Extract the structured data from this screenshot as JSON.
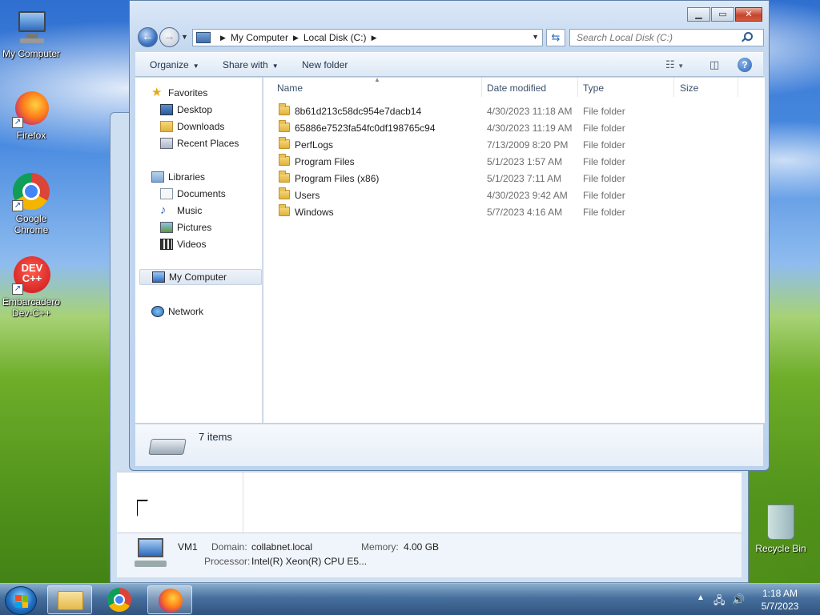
{
  "desktop": {
    "icons": [
      {
        "label": "My Computer"
      },
      {
        "label": "Firefox"
      },
      {
        "label": "Google Chrome"
      },
      {
        "label": "Embarcadero Dev-C++"
      }
    ],
    "recycle_bin": "Recycle Bin"
  },
  "explorer": {
    "address": {
      "segments": [
        "My Computer",
        "Local Disk (C:)"
      ]
    },
    "search_placeholder": "Search Local Disk (C:)",
    "toolbar": {
      "organize": "Organize",
      "share_with": "Share with",
      "new_folder": "New folder"
    },
    "nav": {
      "favorites": "Favorites",
      "desktop": "Desktop",
      "downloads": "Downloads",
      "recent_places": "Recent Places",
      "libraries": "Libraries",
      "documents": "Documents",
      "music": "Music",
      "pictures": "Pictures",
      "videos": "Videos",
      "my_computer": "My Computer",
      "network": "Network"
    },
    "columns": {
      "name": "Name",
      "date_modified": "Date modified",
      "type": "Type",
      "size": "Size"
    },
    "files": [
      {
        "name": "8b61d213c58dc954e7dacb14",
        "date": "4/30/2023 11:18 AM",
        "type": "File folder"
      },
      {
        "name": "65886e7523fa54fc0df198765c94",
        "date": "4/30/2023 11:19 AM",
        "type": "File folder"
      },
      {
        "name": "PerfLogs",
        "date": "7/13/2009 8:20 PM",
        "type": "File folder"
      },
      {
        "name": "Program Files",
        "date": "5/1/2023 1:57 AM",
        "type": "File folder"
      },
      {
        "name": "Program Files (x86)",
        "date": "5/1/2023 7:11 AM",
        "type": "File folder"
      },
      {
        "name": "Users",
        "date": "4/30/2023 9:42 AM",
        "type": "File folder"
      },
      {
        "name": "Windows",
        "date": "5/7/2023 4:16 AM",
        "type": "File folder"
      }
    ],
    "status": "7 items"
  },
  "background_window": {
    "computer_name": "VM1",
    "domain_label": "Domain:",
    "domain_value": "collabnet.local",
    "memory_label": "Memory:",
    "memory_value": "4.00 GB",
    "processor_label": "Processor:",
    "processor_value": "Intel(R) Xeon(R) CPU E5..."
  },
  "taskbar": {
    "time": "1:18 AM",
    "date": "5/7/2023"
  }
}
